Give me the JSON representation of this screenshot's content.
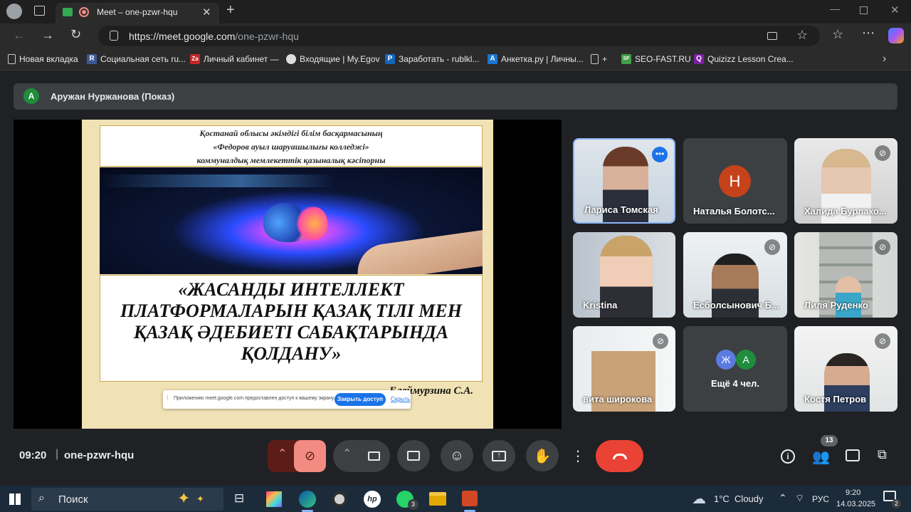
{
  "browser": {
    "tab_title": "Meet – one-pzwr-hqu",
    "url_host": "https://meet.google.com",
    "url_path": "/one-pzwr-hqu",
    "bookmarks": [
      {
        "label": "Новая вкладка",
        "icon": "page-icon"
      },
      {
        "label": "Социальная сеть ru...",
        "icon": "R"
      },
      {
        "label": "Личный кабинет —",
        "icon": "Za"
      },
      {
        "label": "Входящие | My.Egov",
        "icon": "egov-icon"
      },
      {
        "label": "Заработать - rublkl...",
        "icon": "P"
      },
      {
        "label": "Анкетка.ру | Личны...",
        "icon": "A"
      },
      {
        "label": "+",
        "icon": "page-icon"
      },
      {
        "label": "SEO-FAST.RU",
        "icon": "SF"
      },
      {
        "label": "Quizizz Lesson Crea...",
        "icon": "Q"
      }
    ]
  },
  "meet": {
    "presenter_avatar": "А",
    "presenter_label": "Аружан Нуржанова (Показ)",
    "slide": {
      "header_line1": "Қостанай облысы әкімдігі білім басқармасының",
      "header_line2": "«Федоров ауыл шаруашылығы колледжі»",
      "header_line3": "коммуналдық мемлекеттік қазыналық кәсіпорны",
      "title_line1": "«ЖАСАНДЫ ИНТЕЛЛЕКТ",
      "title_line2": "ПЛАТФОРМАЛАРЫН ҚАЗАҚ ТІЛІ МЕН",
      "title_line3": "ҚАЗАҚ ӘДЕБИЕТІ САБАҚТАРЫНДА",
      "title_line4": "ҚОЛДАНУ»",
      "author": "Елеймурзина С.А."
    },
    "share_notice": {
      "text": "Приложению meet.google.com предоставлен доступ к вашему экрану.",
      "close_label": "Закрыть доступ",
      "hide_label": "Скрыть"
    },
    "tiles": [
      {
        "name": "Лариса Томская",
        "type": "video",
        "muted": false,
        "speaking": true
      },
      {
        "name": "Наталья Болотс...",
        "type": "avatar",
        "avatar": "Н",
        "muted": false
      },
      {
        "name": "Халида Бурлако...",
        "type": "video",
        "muted": true
      },
      {
        "name": "Kristina",
        "type": "video",
        "muted": false
      },
      {
        "name": "Есболсынович Б...",
        "type": "video",
        "muted": true
      },
      {
        "name": "Лиля Руденко",
        "type": "video",
        "muted": true
      },
      {
        "name": "вита широкова",
        "type": "video",
        "muted": true
      },
      {
        "name": "Ещё 4 чел.",
        "type": "more",
        "avatars": [
          "Ж",
          "А"
        ]
      },
      {
        "name": "Костя Петров",
        "type": "video",
        "muted": true
      }
    ],
    "time": "09:20",
    "meeting_code": "one-pzwr-hqu",
    "participants_count": "13"
  },
  "taskbar": {
    "search_label": "Поиск",
    "weather": "1°C  Cloudy",
    "language": "РУС",
    "time": "9:20",
    "date": "14.03.2025",
    "whatsapp_badge": "3",
    "notification_count": "2"
  },
  "colors": {
    "accent_blue": "#8ab4f8",
    "hangup_red": "#ea4335",
    "mic_off_red": "#f28b82",
    "avatar_red": "#c5421a",
    "avatar_green": "#1e8e3e"
  }
}
